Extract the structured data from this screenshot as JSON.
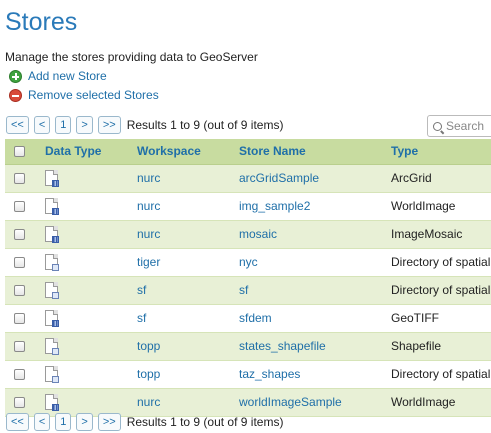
{
  "page": {
    "title": "Stores",
    "description": "Manage the stores providing data to GeoServer"
  },
  "actions": {
    "add_label": "Add new Store",
    "remove_label": "Remove selected Stores"
  },
  "pager": {
    "first": "<<",
    "prev": "<",
    "page": "1",
    "next": ">",
    "last": ">>",
    "results_text": "Results 1 to 9 (out of 9 items)"
  },
  "search": {
    "placeholder": "Search",
    "value": ""
  },
  "table": {
    "headers": {
      "data_type": "Data Type",
      "workspace": "Workspace",
      "store_name": "Store Name",
      "type": "Type"
    },
    "rows": [
      {
        "icon": "raster-store-icon",
        "workspace": "nurc",
        "store_name": "arcGridSample",
        "type": "ArcGrid"
      },
      {
        "icon": "raster-store-icon",
        "workspace": "nurc",
        "store_name": "img_sample2",
        "type": "WorldImage"
      },
      {
        "icon": "raster-store-icon",
        "workspace": "nurc",
        "store_name": "mosaic",
        "type": "ImageMosaic"
      },
      {
        "icon": "vector-store-icon",
        "workspace": "tiger",
        "store_name": "nyc",
        "type": "Directory of spatial files (shapefiles)"
      },
      {
        "icon": "vector-store-icon",
        "workspace": "sf",
        "store_name": "sf",
        "type": "Directory of spatial files (shapefiles)"
      },
      {
        "icon": "raster-store-icon",
        "workspace": "sf",
        "store_name": "sfdem",
        "type": "GeoTIFF"
      },
      {
        "icon": "vector-store-icon",
        "workspace": "topp",
        "store_name": "states_shapefile",
        "type": "Shapefile"
      },
      {
        "icon": "vector-store-icon",
        "workspace": "topp",
        "store_name": "taz_shapes",
        "type": "Directory of spatial files (shapefiles)"
      },
      {
        "icon": "raster-store-icon",
        "workspace": "nurc",
        "store_name": "worldImageSample",
        "type": "WorldImage"
      }
    ]
  },
  "colors": {
    "title": "#2a7ab9",
    "link": "#1f6fa8",
    "header_bg": "#c8dca0",
    "odd_row_bg": "#e8f0d6"
  }
}
